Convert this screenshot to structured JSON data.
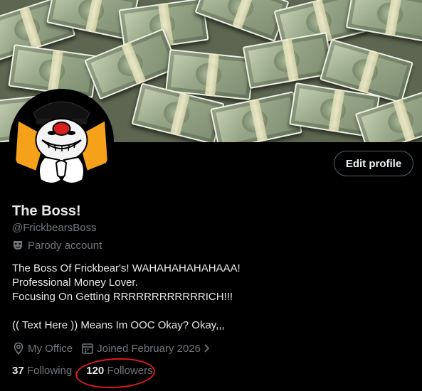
{
  "profile": {
    "display_name": "The Boss!",
    "handle": "@FrickbearsBoss",
    "badge_label": "Parody account",
    "edit_button_label": "Edit profile",
    "bio_lines": [
      "The Boss Of Frickbear's! WAHAHAHAHAHAAA!",
      "Professional Money Lover.",
      "Focusing On Getting RRRRRRRRRRRRICH!!!",
      "",
      "(( Text Here )) Means Im OOC Okay? Okay,,,"
    ],
    "location": "My Office",
    "joined": "Joined February 2026",
    "following_count": "37",
    "following_label": "Following",
    "followers_count": "120",
    "followers_label": "Followers"
  },
  "icons": {
    "badge": "theater-masks-icon",
    "location": "location-pin-icon",
    "joined": "calendar-icon",
    "joined_more": "chevron-right-icon"
  },
  "colors": {
    "background": "#000000",
    "text_primary": "#e7e9ea",
    "text_secondary": "#71767b",
    "button_border": "#536471",
    "annotation": "#e0181c"
  }
}
